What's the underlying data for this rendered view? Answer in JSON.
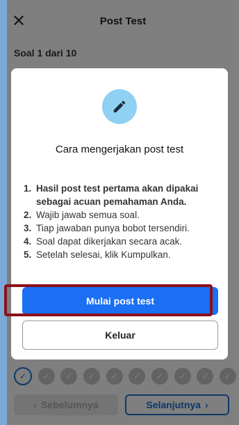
{
  "header": {
    "close_icon": "✕",
    "title": "Post Test"
  },
  "progress": {
    "text": "Soal 1 dari 10",
    "current": 1,
    "total": 10
  },
  "modal": {
    "icon": "pencil-icon",
    "title": "Cara mengerjakan post test",
    "rules": [
      {
        "num": "1.",
        "text": "Hasil post test pertama akan dipakai sebagai acuan pemahaman Anda."
      },
      {
        "num": "2.",
        "text": "Wajib jawab semua soal."
      },
      {
        "num": "3.",
        "text": "Tiap jawaban punya bobot tersendiri."
      },
      {
        "num": "4.",
        "text": "Soal dapat dikerjakan secara acak."
      },
      {
        "num": "5.",
        "text": "Setelah selesai, klik Kumpulkan."
      }
    ],
    "start_label": "Mulai post test",
    "exit_label": "Keluar"
  },
  "navigation": {
    "prev_label": "Sebelumnya",
    "next_label": "Selanjutnya",
    "prev_icon": "‹",
    "next_icon": "›"
  },
  "colors": {
    "primary": "#1a6ff2",
    "highlight": "#8b0f1a",
    "icon_bg": "#8fd0f3"
  }
}
